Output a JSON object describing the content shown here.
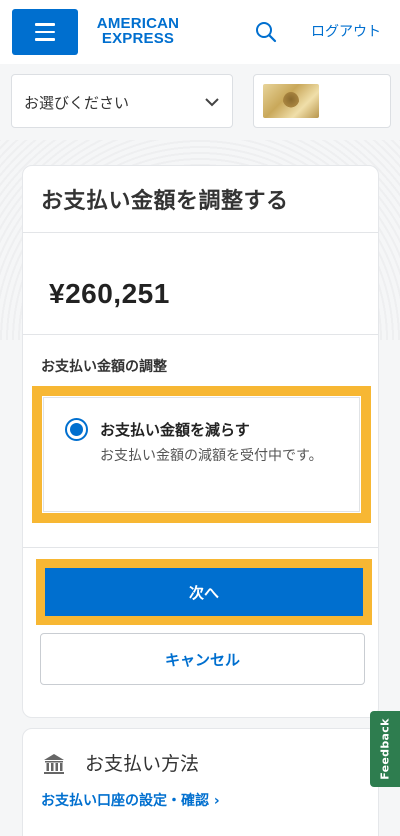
{
  "header": {
    "brand_line1": "AMERICAN",
    "brand_line2": "EXPRESS",
    "logout_label": "ログアウト"
  },
  "selectors": {
    "account_select_value": "お選びください"
  },
  "adjust_payment": {
    "title": "お支払い金額を調整する",
    "amount": "¥260,251",
    "section_label": "お支払い金額の調整",
    "option_title": "お支払い金額を減らす",
    "option_description": "お支払い金額の減額を受付中です。",
    "next_button_label": "次へ",
    "cancel_button_label": "キャンセル"
  },
  "payment_method": {
    "title": "お支払い方法",
    "link_label": "お支払い口座の設定・確認 ›"
  },
  "feedback": {
    "label": "Feedback"
  },
  "colors": {
    "brand_blue": "#006fcf",
    "highlight_yellow": "#f7b733",
    "feedback_green": "#2e7d4f"
  },
  "icons": [
    "menu-icon",
    "search-icon",
    "chevron-down-icon",
    "bank-icon"
  ]
}
